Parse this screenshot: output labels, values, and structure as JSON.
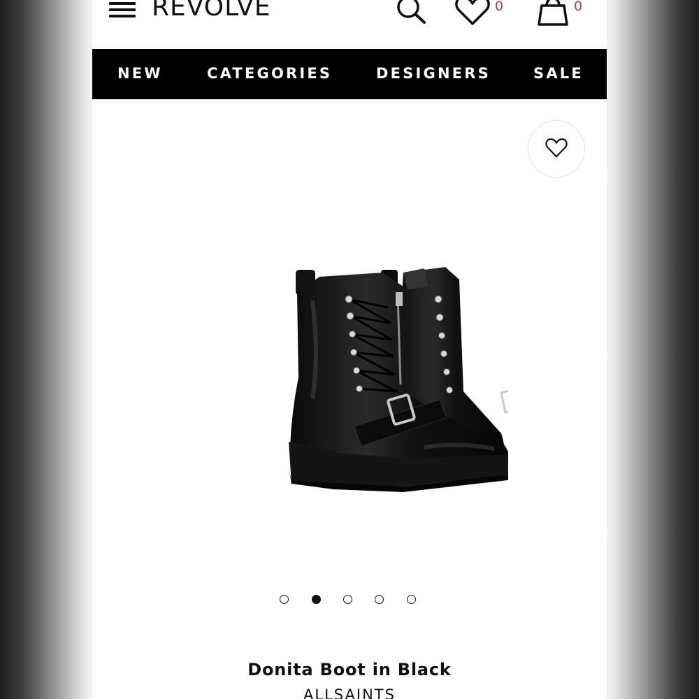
{
  "header": {
    "logo": "REVOLVE",
    "wishlist_count": "0",
    "bag_count": "0",
    "icons": [
      "menu-icon",
      "search-icon",
      "heart-icon",
      "shopping-bag-icon"
    ]
  },
  "nav": {
    "items": [
      {
        "label": "NEW"
      },
      {
        "label": "CATEGORIES"
      },
      {
        "label": "DESIGNERS"
      },
      {
        "label": "SALE"
      }
    ]
  },
  "product": {
    "name": "Donita Boot in Black",
    "brand": "ALLSAINTS",
    "image_slides": 5,
    "active_slide": 2
  },
  "colors": {
    "nav_background": "#000000",
    "badge": "#b5318c",
    "text": "#111111"
  }
}
